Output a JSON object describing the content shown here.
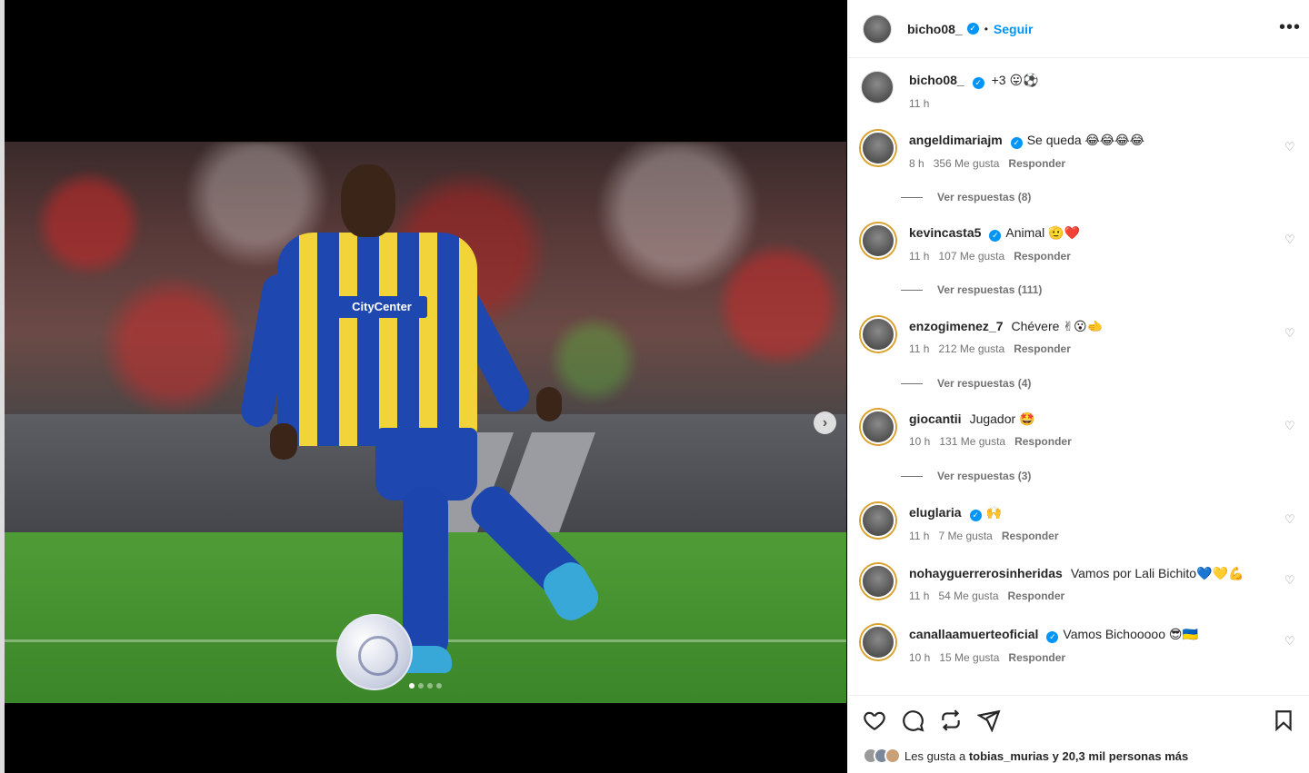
{
  "post": {
    "author": "bicho08_",
    "follow_label": "Seguir",
    "caption": "+3 😛⚽",
    "caption_time": "11 h",
    "photo": {
      "sponsor_text": "CityCenter",
      "carousel_dots": 4,
      "active_dot": 1
    }
  },
  "header": {
    "more_label": "•••"
  },
  "comments": [
    {
      "user": "angeldimariajm",
      "verified": true,
      "text": "Se queda 😂😂😂😂",
      "time": "8 h",
      "likes": "356 Me gusta",
      "reply": "Responder",
      "replies": "Ver respuestas (8)"
    },
    {
      "user": "kevincasta5",
      "verified": true,
      "text": "Animal 🫡❤️",
      "time": "11 h",
      "likes": "107 Me gusta",
      "reply": "Responder",
      "replies": "Ver respuestas (111)"
    },
    {
      "user": "enzogimenez_7",
      "verified": false,
      "text": "Chévere ✌😮🫲",
      "time": "11 h",
      "likes": "212 Me gusta",
      "reply": "Responder",
      "replies": "Ver respuestas (4)"
    },
    {
      "user": "giocantii",
      "verified": false,
      "text": "Jugador 🤩",
      "time": "10 h",
      "likes": "131 Me gusta",
      "reply": "Responder",
      "replies": "Ver respuestas (3)"
    },
    {
      "user": "eluglaria",
      "verified": true,
      "text": "🙌",
      "time": "11 h",
      "likes": "7 Me gusta",
      "reply": "Responder",
      "replies": ""
    },
    {
      "user": "nohayguerrerosinheridas",
      "verified": false,
      "text": "Vamos por Lali Bichito💙💛💪",
      "time": "11 h",
      "likes": "54 Me gusta",
      "reply": "Responder",
      "replies": ""
    },
    {
      "user": "canallaamuerteoficial",
      "verified": true,
      "text": "Vamos Bichooooo 😎🇺🇦",
      "time": "10 h",
      "likes": "15 Me gusta",
      "reply": "Responder",
      "replies": ""
    }
  ],
  "footer": {
    "likes_prefix": "Les gusta a",
    "likes_user": "tobias_murias",
    "likes_suffix": "y 20,3 mil personas más"
  },
  "colors": {
    "accent": "#0095f6",
    "jersey_blue": "#1f47b0",
    "jersey_yellow": "#f2d43a"
  }
}
